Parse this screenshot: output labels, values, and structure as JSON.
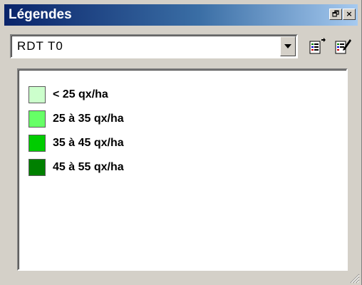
{
  "window": {
    "title": "Légendes",
    "restore_icon": "restore-icon",
    "close_icon": "close-icon",
    "restore_glyph": "🗗",
    "close_glyph": "×"
  },
  "toolbar": {
    "layer_select_value": "RDT T0",
    "dropdown_icon": "chevron-down-icon",
    "icons": [
      "legend-properties-icon",
      "legend-edit-icon"
    ]
  },
  "legend": {
    "items": [
      {
        "label": "< 25 qx/ha",
        "color": "#ccffcc"
      },
      {
        "label": "25 à 35 qx/ha",
        "color": "#66ff66"
      },
      {
        "label": "35 à 45 qx/ha",
        "color": "#00cc00"
      },
      {
        "label": "45 à 55 qx/ha",
        "color": "#008000"
      }
    ]
  },
  "colors": {
    "titlebar_start": "#0a246a",
    "titlebar_end": "#a6caf0",
    "face": "#d4d0c8"
  }
}
